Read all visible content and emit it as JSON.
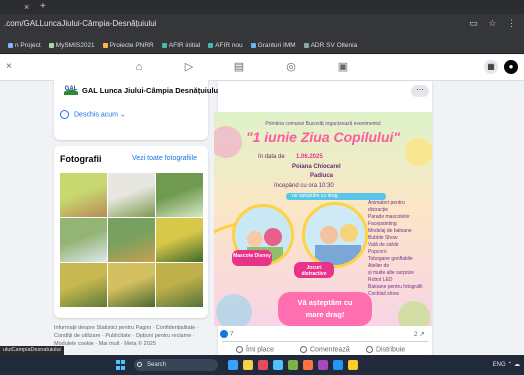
{
  "browser": {
    "tab_close": "×",
    "tab_new": "+",
    "url": ".com/GALLuncaJiului-Câmpia-Desnățuiului",
    "bookmarks": [
      {
        "label": "n Project",
        "color": "#8ab4f8"
      },
      {
        "label": "MySMIS2021",
        "color": "#a5d6a7"
      },
      {
        "label": "Proiecte PNRR",
        "color": "#ffb74d"
      },
      {
        "label": "AFIR initial",
        "color": "#4db6ac"
      },
      {
        "label": "AFIR nou",
        "color": "#4db6ac"
      },
      {
        "label": "Granturi IMM",
        "color": "#64b5f6"
      },
      {
        "label": "ADR SV Oltenia",
        "color": "#90a4ae"
      }
    ]
  },
  "nav": {
    "close": "×",
    "icons": [
      "home-icon",
      "video-icon",
      "marketplace-icon",
      "groups-icon",
      "gaming-icon"
    ]
  },
  "page_card": {
    "logo_text": "GAL",
    "title": "GAL Lunca Jiului-Câmpia Desnățuiului",
    "open_status": "Deschis acum",
    "open_chevron": "⌄"
  },
  "photos": {
    "title": "Fotografii",
    "see_all": "Vezi toate fotografiile",
    "thumb_colors": [
      [
        "#c8d870",
        "#b78a55"
      ],
      [
        "#e8e6e0",
        "#7a9a4a"
      ],
      [
        "#6f9a4f",
        "#d9e8c8"
      ],
      [
        "#93b474",
        "#e0e8f0"
      ],
      [
        "#78a060",
        "#c8a050"
      ],
      [
        "#d8c84a",
        "#3f6a2a"
      ],
      [
        "#c8b850",
        "#5e7a38"
      ],
      [
        "#d4c060",
        "#4a6a2e"
      ],
      [
        "#c0b04a",
        "#52733a"
      ]
    ]
  },
  "footer_text": "Informații despre Statistici pentru Pagini · Confidențialitate · Condiții de utilizare · Publicitate · Opțiuni pentru reclame · Modulele cookie · Mai mult · Meta © 2025",
  "post": {
    "menu": "···",
    "poster": {
      "header": "Primăria comunei Bucovăț organizează evenimentul",
      "title": "\"1 iunie Ziua Copilului\"",
      "date_label": "în data de",
      "date_value": "1.06.2025",
      "place1": "Poiana Chiocarel",
      "place2": "Padiuca",
      "start": "începând cu ora 10:30",
      "subtitle": "ne așteptăm cu drag",
      "tag1": "Mascote Disney",
      "tag2": "Jocuri distractive",
      "activities": [
        "Animatori pentru",
        "distracție",
        "Parade mascotelor",
        "Facepainting",
        "Modelaj de baloane",
        "Bubble Show",
        "Vată de zahăr",
        "Popcorn",
        "Tobogane gonflabile",
        "Atelier de",
        "și multe alte surprize",
        "Robot LED",
        "Baloane pentru fotografii",
        "Cocktail show"
      ],
      "cta_line1": "Vă așteptăm cu",
      "cta_line2": "mare drag!"
    },
    "reactions_count": "7",
    "shares": "2 ↗",
    "like": "Îmi place",
    "comment": "Comentează",
    "share": "Distribuie"
  },
  "status_tip": "uluiCampiaDesnatuiului",
  "taskbar": {
    "search": "Search",
    "apps": [
      "#3aa0ff",
      "#f5d14a",
      "#e84a5f",
      "#4cc2ff",
      "#7cb342",
      "#ff7043",
      "#ab47bc",
      "#2196f3",
      "#ffca28"
    ],
    "tray": "ENG   ⌃ ☁"
  }
}
